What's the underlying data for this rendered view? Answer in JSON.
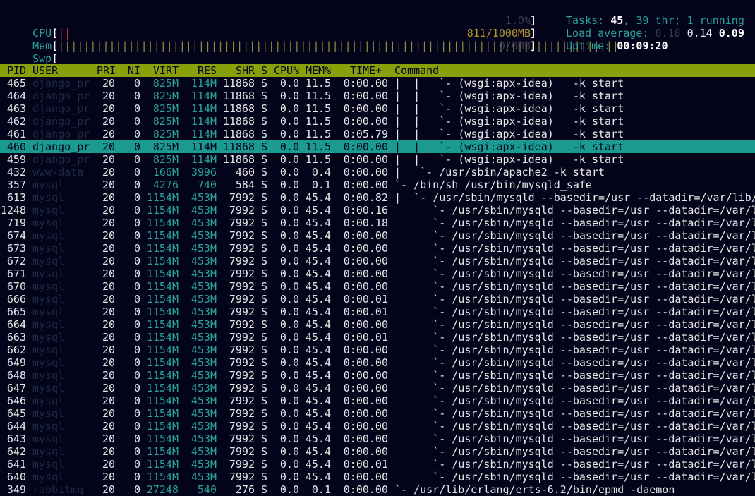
{
  "meters": {
    "cpu": {
      "label": "CPU",
      "bar_red": "||",
      "bar": "",
      "value": "1.0%"
    },
    "mem": {
      "label": "Mem",
      "bar": "||||||||||||||||||||||||||||||||||||||||||||||||||||||||||||||||||||||||||||||||||||||||",
      "value": "811/1000MB"
    },
    "swp": {
      "label": "Swp",
      "bar": "",
      "value": "0/0MB"
    }
  },
  "system": {
    "tasks_label": "Tasks: ",
    "tasks": "45",
    "threads_text": ", 39 thr; 1 running",
    "load_label": "Load average: ",
    "load_1": "0.18",
    "load_5": "0.14",
    "load_15": "0.09",
    "uptime_label": "Uptime: ",
    "uptime": "00:09:20"
  },
  "columns": {
    "pid": "PID",
    "user": "USER",
    "pri": "PRI",
    "ni": "NI",
    "virt": "VIRT",
    "res": "RES",
    "shr": "SHR",
    "s": "S",
    "cpu": "CPU%",
    "mem": "MEM%",
    "time": "TIME+",
    "command": "Command"
  },
  "processes": [
    {
      "pid": "465",
      "user": "django_pr",
      "pri": "20",
      "ni": "0",
      "virt": "825M",
      "res": "114M",
      "shr": "11868",
      "s": "S",
      "cpu": "0.0",
      "mem": "11.5",
      "time": "0:00.00",
      "tree": "|  |   `- ",
      "cmd": "(wsgi:apx-idea)   -k start"
    },
    {
      "pid": "464",
      "user": "django_pr",
      "pri": "20",
      "ni": "0",
      "virt": "825M",
      "res": "114M",
      "shr": "11868",
      "s": "S",
      "cpu": "0.0",
      "mem": "11.5",
      "time": "0:00.00",
      "tree": "|  |   `- ",
      "cmd": "(wsgi:apx-idea)   -k start"
    },
    {
      "pid": "463",
      "user": "django_pr",
      "pri": "20",
      "ni": "0",
      "virt": "825M",
      "res": "114M",
      "shr": "11868",
      "s": "S",
      "cpu": "0.0",
      "mem": "11.5",
      "time": "0:00.00",
      "tree": "|  |   `- ",
      "cmd": "(wsgi:apx-idea)   -k start"
    },
    {
      "pid": "462",
      "user": "django_pr",
      "pri": "20",
      "ni": "0",
      "virt": "825M",
      "res": "114M",
      "shr": "11868",
      "s": "S",
      "cpu": "0.0",
      "mem": "11.5",
      "time": "0:00.00",
      "tree": "|  |   `- ",
      "cmd": "(wsgi:apx-idea)   -k start"
    },
    {
      "pid": "461",
      "user": "django_pr",
      "pri": "20",
      "ni": "0",
      "virt": "825M",
      "res": "114M",
      "shr": "11868",
      "s": "S",
      "cpu": "0.0",
      "mem": "11.5",
      "time": "0:05.79",
      "tree": "|  |   `- ",
      "cmd": "(wsgi:apx-idea)   -k start"
    },
    {
      "pid": "460",
      "user": "django_pr",
      "pri": "20",
      "ni": "0",
      "virt": "825M",
      "res": "114M",
      "shr": "11868",
      "s": "S",
      "cpu": "0.0",
      "mem": "11.5",
      "time": "0:00.00",
      "tree": "|  |   `- ",
      "cmd": "(wsgi:apx-idea)   -k start",
      "selected": true
    },
    {
      "pid": "459",
      "user": "django_pr",
      "pri": "20",
      "ni": "0",
      "virt": "825M",
      "res": "114M",
      "shr": "11868",
      "s": "S",
      "cpu": "0.0",
      "mem": "11.5",
      "time": "0:00.00",
      "tree": "|  |   `- ",
      "cmd": "(wsgi:apx-idea)   -k start"
    },
    {
      "pid": "432",
      "user": "www-data",
      "pri": "20",
      "ni": "0",
      "virt": "166M",
      "res": "3996",
      "shr": "460",
      "s": "S",
      "cpu": "0.0",
      "mem": "0.4",
      "time": "0:00.00",
      "tree": "|   `- ",
      "cmd": "/usr/sbin/apache2 -k start"
    },
    {
      "pid": "357",
      "user": "mysql",
      "pri": "20",
      "ni": "0",
      "virt": "4276",
      "res": "740",
      "shr": "584",
      "s": "S",
      "cpu": "0.0",
      "mem": "0.1",
      "time": "0:00.00",
      "tree": "`- ",
      "cmd": "/bin/sh /usr/bin/mysqld_safe"
    },
    {
      "pid": "613",
      "user": "mysql",
      "pri": "20",
      "ni": "0",
      "virt": "1154M",
      "res": "453M",
      "shr": "7992",
      "s": "S",
      "cpu": "0.0",
      "mem": "45.4",
      "time": "0:00.82",
      "tree": "|  `- ",
      "cmd": "/usr/sbin/mysqld --basedir=/usr --datadir=/var/lib/"
    },
    {
      "pid": "1248",
      "user": "mysql",
      "pri": "20",
      "ni": "0",
      "virt": "1154M",
      "res": "453M",
      "shr": "7992",
      "s": "S",
      "cpu": "0.0",
      "mem": "45.4",
      "time": "0:00.16",
      "tree": "      `- ",
      "cmd": "/usr/sbin/mysqld --basedir=/usr --datadir=/var/l"
    },
    {
      "pid": "719",
      "user": "mysql",
      "pri": "20",
      "ni": "0",
      "virt": "1154M",
      "res": "453M",
      "shr": "7992",
      "s": "S",
      "cpu": "0.0",
      "mem": "45.4",
      "time": "0:00.18",
      "tree": "      `- ",
      "cmd": "/usr/sbin/mysqld --basedir=/usr --datadir=/var/l"
    },
    {
      "pid": "674",
      "user": "mysql",
      "pri": "20",
      "ni": "0",
      "virt": "1154M",
      "res": "453M",
      "shr": "7992",
      "s": "S",
      "cpu": "0.0",
      "mem": "45.4",
      "time": "0:00.00",
      "tree": "      `- ",
      "cmd": "/usr/sbin/mysqld --basedir=/usr --datadir=/var/l"
    },
    {
      "pid": "673",
      "user": "mysql",
      "pri": "20",
      "ni": "0",
      "virt": "1154M",
      "res": "453M",
      "shr": "7992",
      "s": "S",
      "cpu": "0.0",
      "mem": "45.4",
      "time": "0:00.00",
      "tree": "      `- ",
      "cmd": "/usr/sbin/mysqld --basedir=/usr --datadir=/var/l"
    },
    {
      "pid": "672",
      "user": "mysql",
      "pri": "20",
      "ni": "0",
      "virt": "1154M",
      "res": "453M",
      "shr": "7992",
      "s": "S",
      "cpu": "0.0",
      "mem": "45.4",
      "time": "0:00.00",
      "tree": "      `- ",
      "cmd": "/usr/sbin/mysqld --basedir=/usr --datadir=/var/l"
    },
    {
      "pid": "671",
      "user": "mysql",
      "pri": "20",
      "ni": "0",
      "virt": "1154M",
      "res": "453M",
      "shr": "7992",
      "s": "S",
      "cpu": "0.0",
      "mem": "45.4",
      "time": "0:00.00",
      "tree": "      `- ",
      "cmd": "/usr/sbin/mysqld --basedir=/usr --datadir=/var/l"
    },
    {
      "pid": "670",
      "user": "mysql",
      "pri": "20",
      "ni": "0",
      "virt": "1154M",
      "res": "453M",
      "shr": "7992",
      "s": "S",
      "cpu": "0.0",
      "mem": "45.4",
      "time": "0:00.00",
      "tree": "      `- ",
      "cmd": "/usr/sbin/mysqld --basedir=/usr --datadir=/var/l"
    },
    {
      "pid": "666",
      "user": "mysql",
      "pri": "20",
      "ni": "0",
      "virt": "1154M",
      "res": "453M",
      "shr": "7992",
      "s": "S",
      "cpu": "0.0",
      "mem": "45.4",
      "time": "0:00.01",
      "tree": "      `- ",
      "cmd": "/usr/sbin/mysqld --basedir=/usr --datadir=/var/l"
    },
    {
      "pid": "665",
      "user": "mysql",
      "pri": "20",
      "ni": "0",
      "virt": "1154M",
      "res": "453M",
      "shr": "7992",
      "s": "S",
      "cpu": "0.0",
      "mem": "45.4",
      "time": "0:00.01",
      "tree": "      `- ",
      "cmd": "/usr/sbin/mysqld --basedir=/usr --datadir=/var/l"
    },
    {
      "pid": "664",
      "user": "mysql",
      "pri": "20",
      "ni": "0",
      "virt": "1154M",
      "res": "453M",
      "shr": "7992",
      "s": "S",
      "cpu": "0.0",
      "mem": "45.4",
      "time": "0:00.00",
      "tree": "      `- ",
      "cmd": "/usr/sbin/mysqld --basedir=/usr --datadir=/var/l"
    },
    {
      "pid": "663",
      "user": "mysql",
      "pri": "20",
      "ni": "0",
      "virt": "1154M",
      "res": "453M",
      "shr": "7992",
      "s": "S",
      "cpu": "0.0",
      "mem": "45.4",
      "time": "0:00.01",
      "tree": "      `- ",
      "cmd": "/usr/sbin/mysqld --basedir=/usr --datadir=/var/l"
    },
    {
      "pid": "662",
      "user": "mysql",
      "pri": "20",
      "ni": "0",
      "virt": "1154M",
      "res": "453M",
      "shr": "7992",
      "s": "S",
      "cpu": "0.0",
      "mem": "45.4",
      "time": "0:00.00",
      "tree": "      `- ",
      "cmd": "/usr/sbin/mysqld --basedir=/usr --datadir=/var/l"
    },
    {
      "pid": "649",
      "user": "mysql",
      "pri": "20",
      "ni": "0",
      "virt": "1154M",
      "res": "453M",
      "shr": "7992",
      "s": "S",
      "cpu": "0.0",
      "mem": "45.4",
      "time": "0:00.00",
      "tree": "      `- ",
      "cmd": "/usr/sbin/mysqld --basedir=/usr --datadir=/var/l"
    },
    {
      "pid": "648",
      "user": "mysql",
      "pri": "20",
      "ni": "0",
      "virt": "1154M",
      "res": "453M",
      "shr": "7992",
      "s": "S",
      "cpu": "0.0",
      "mem": "45.4",
      "time": "0:00.00",
      "tree": "      `- ",
      "cmd": "/usr/sbin/mysqld --basedir=/usr --datadir=/var/l"
    },
    {
      "pid": "647",
      "user": "mysql",
      "pri": "20",
      "ni": "0",
      "virt": "1154M",
      "res": "453M",
      "shr": "7992",
      "s": "S",
      "cpu": "0.0",
      "mem": "45.4",
      "time": "0:00.00",
      "tree": "      `- ",
      "cmd": "/usr/sbin/mysqld --basedir=/usr --datadir=/var/l"
    },
    {
      "pid": "646",
      "user": "mysql",
      "pri": "20",
      "ni": "0",
      "virt": "1154M",
      "res": "453M",
      "shr": "7992",
      "s": "S",
      "cpu": "0.0",
      "mem": "45.4",
      "time": "0:00.00",
      "tree": "      `- ",
      "cmd": "/usr/sbin/mysqld --basedir=/usr --datadir=/var/l"
    },
    {
      "pid": "645",
      "user": "mysql",
      "pri": "20",
      "ni": "0",
      "virt": "1154M",
      "res": "453M",
      "shr": "7992",
      "s": "S",
      "cpu": "0.0",
      "mem": "45.4",
      "time": "0:00.00",
      "tree": "      `- ",
      "cmd": "/usr/sbin/mysqld --basedir=/usr --datadir=/var/l"
    },
    {
      "pid": "644",
      "user": "mysql",
      "pri": "20",
      "ni": "0",
      "virt": "1154M",
      "res": "453M",
      "shr": "7992",
      "s": "S",
      "cpu": "0.0",
      "mem": "45.4",
      "time": "0:00.00",
      "tree": "      `- ",
      "cmd": "/usr/sbin/mysqld --basedir=/usr --datadir=/var/l"
    },
    {
      "pid": "643",
      "user": "mysql",
      "pri": "20",
      "ni": "0",
      "virt": "1154M",
      "res": "453M",
      "shr": "7992",
      "s": "S",
      "cpu": "0.0",
      "mem": "45.4",
      "time": "0:00.00",
      "tree": "      `- ",
      "cmd": "/usr/sbin/mysqld --basedir=/usr --datadir=/var/l"
    },
    {
      "pid": "642",
      "user": "mysql",
      "pri": "20",
      "ni": "0",
      "virt": "1154M",
      "res": "453M",
      "shr": "7992",
      "s": "S",
      "cpu": "0.0",
      "mem": "45.4",
      "time": "0:00.00",
      "tree": "      `- ",
      "cmd": "/usr/sbin/mysqld --basedir=/usr --datadir=/var/l"
    },
    {
      "pid": "641",
      "user": "mysql",
      "pri": "20",
      "ni": "0",
      "virt": "1154M",
      "res": "453M",
      "shr": "7992",
      "s": "S",
      "cpu": "0.0",
      "mem": "45.4",
      "time": "0:00.01",
      "tree": "      `- ",
      "cmd": "/usr/sbin/mysqld --basedir=/usr --datadir=/var/l"
    },
    {
      "pid": "640",
      "user": "mysql",
      "pri": "20",
      "ni": "0",
      "virt": "1154M",
      "res": "453M",
      "shr": "7992",
      "s": "S",
      "cpu": "0.0",
      "mem": "45.4",
      "time": "0:00.00",
      "tree": "      `- ",
      "cmd": "/usr/sbin/mysqld --basedir=/usr --datadir=/var/l"
    },
    {
      "pid": "349",
      "user": "rabbitmq",
      "pri": "20",
      "ni": "0",
      "virt": "27248",
      "res": "540",
      "shr": "276",
      "s": "S",
      "cpu": "0.0",
      "mem": "0.1",
      "time": "0:00.00",
      "tree": "`- ",
      "cmd": "/usr/lib/erlang/erts-6.2/bin/epmd -daemon"
    }
  ]
}
